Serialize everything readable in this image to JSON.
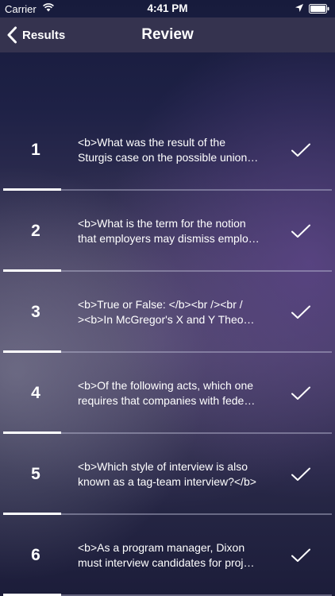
{
  "status_bar": {
    "carrier": "Carrier",
    "time": "4:41 PM",
    "icons": [
      "wifi-icon",
      "location-icon",
      "battery-icon"
    ]
  },
  "nav": {
    "back_label": "Results",
    "title": "Review"
  },
  "rows": [
    {
      "number": "1",
      "line1": "<b>What was the result of the",
      "line2": "Sturgis case on the possible union…",
      "status_icon": "check-icon"
    },
    {
      "number": "2",
      "line1": "<b>What is the term for the notion",
      "line2": "that employers may dismiss emplo…",
      "status_icon": "check-icon"
    },
    {
      "number": "3",
      "line1": "<b>True or False: </b><br /><br /",
      "line2": "><b>In McGregor's X and Y Theo…",
      "status_icon": "check-icon"
    },
    {
      "number": "4",
      "line1": "<b>Of the following acts, which one",
      "line2": "requires that companies with fede…",
      "status_icon": "check-icon"
    },
    {
      "number": "5",
      "line1": "<b>Which style of interview is also",
      "line2": "known as a tag-team interview?</b>",
      "status_icon": "check-icon"
    },
    {
      "number": "6",
      "line1": "<b>As a program manager, Dixon",
      "line2": "must interview candidates for proj…",
      "status_icon": "check-icon"
    }
  ],
  "colors": {
    "nav_background": "#35334f",
    "text": "#ffffff"
  }
}
